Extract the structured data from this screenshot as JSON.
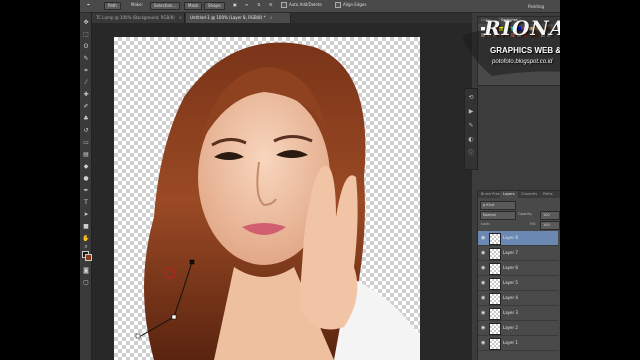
{
  "options_bar": {
    "tool_mode": "Path",
    "make_label": "Make:",
    "selection_button": "Selection...",
    "mask_button": "Mask",
    "shape_button": "Shape",
    "auto_add_delete": "Auto Add/Delete",
    "align_edges": "Align Edges"
  },
  "tabs": [
    {
      "label": "TC Lamp @ 100% (Background, RGB/8)",
      "active": false
    },
    {
      "label": "Untitled-1 @ 100% (Layer 8, RGB/8) *",
      "active": true
    }
  ],
  "tools": [
    "move",
    "marquee",
    "lasso",
    "quick-select",
    "crop",
    "eyedropper",
    "heal",
    "brush",
    "stamp",
    "history",
    "eraser",
    "gradient",
    "blur",
    "dodge",
    "pen",
    "type",
    "path-select",
    "shape",
    "hand",
    "zoom"
  ],
  "right_panel": {
    "color_tabs": [
      "Color",
      "Swatches"
    ],
    "painting_label": "Painting",
    "swatch_colors": [
      "#ffffff",
      "#000000",
      "#ff0000",
      "#ffff00",
      "#00ff00",
      "#00ffff",
      "#0000ff",
      "#ff00ff",
      "#c8a070",
      "#8a5a30",
      "#5a3a20",
      "#3a2818",
      "#f0c8a0",
      "#d4a07a",
      "#b07850",
      "#905030",
      "#e05030",
      "#f08070",
      "#ffb090",
      "#c04020",
      "#a03018",
      "#703010",
      "#e8e8e8",
      "#a0a0a0"
    ]
  },
  "layers_panel": {
    "tabs": [
      "Brush Prese",
      "Layers",
      "Channels",
      "Paths"
    ],
    "filter_kind": "Kind",
    "blend_mode": "Normal",
    "opacity_label": "Opacity:",
    "opacity_value": "100",
    "lock_label": "Lock:",
    "fill_label": "Fill:",
    "fill_value": "100",
    "layers": [
      {
        "name": "Layer 8",
        "selected": true
      },
      {
        "name": "Layer 7",
        "selected": false
      },
      {
        "name": "Layer 6",
        "selected": false
      },
      {
        "name": "Layer 5",
        "selected": false
      },
      {
        "name": "Layer 4",
        "selected": false
      },
      {
        "name": "Layer 3",
        "selected": false
      },
      {
        "name": "Layer 2",
        "selected": false
      },
      {
        "name": "Layer 1",
        "selected": false
      }
    ]
  },
  "watermark": {
    "title": "RIONALDO",
    "subtitle": "GRAPHICS WEB & APPS",
    "url": "potofoto.blogspot.co.id"
  },
  "colors": {
    "ui_dark": "#3c3c3c",
    "selection_blue": "#6b88b3",
    "hair": "#8a3a1c",
    "skin": "#f2c9ae"
  }
}
